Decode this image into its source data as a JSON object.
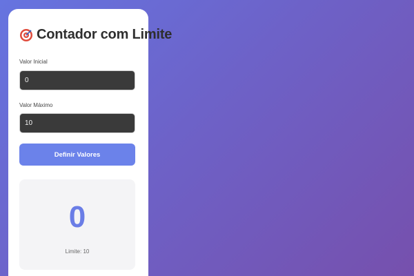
{
  "app": {
    "title": "Contador com Limite",
    "icon": "target-icon"
  },
  "form": {
    "initial_label": "Valor Inicial",
    "initial_value": "0",
    "max_label": "Valor Máximo",
    "max_value": "10",
    "submit_label": "Definir Valores"
  },
  "counter": {
    "value": "0",
    "limit_text": "Limite: 10"
  },
  "colors": {
    "accent": "#6b82ea",
    "counter": "#6a7de6",
    "background_start": "#6674e0",
    "background_end": "#7650ad"
  }
}
